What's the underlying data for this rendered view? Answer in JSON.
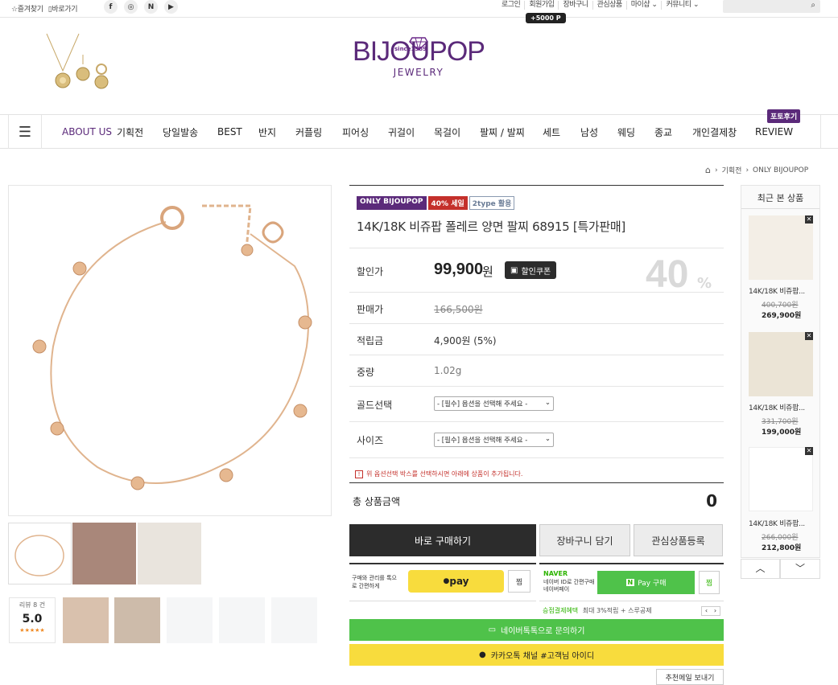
{
  "topbar": {
    "bookmark": "☆즐겨찾기",
    "shortcut": "▯바로가기",
    "links": [
      "로그인",
      "회원가입",
      "장바구니",
      "관심상품",
      "마이샵 ⌄",
      "커뮤니티 ⌄"
    ],
    "point_tag": "+5000 P"
  },
  "logo": {
    "since": "since1989",
    "main": "BIJOUPOP",
    "sub": "JEWELRY"
  },
  "nav": {
    "items": [
      "ABOUT US",
      "기획전",
      "당일발송",
      "BEST",
      "반지",
      "커플링",
      "피어싱",
      "귀걸이",
      "목걸이",
      "팔찌 / 발찌",
      "세트",
      "남성",
      "웨딩",
      "종교",
      "개인결제창",
      "REVIEW"
    ],
    "photo_review": "포토후기"
  },
  "breadcrumb": [
    "기획전",
    "ONLY BIJOUPOP"
  ],
  "product": {
    "badges": [
      "ONLY BIJOUPOP",
      "40% 세일",
      "2type 활용"
    ],
    "title": "14K/18K 비쥬팝 폴레르 양면 팔찌 68915 [특가판매]",
    "sale_label": "할인가",
    "sale_price": "99,900",
    "won": "원",
    "coupon": "할인쿠폰",
    "discount_num": "40",
    "discount_pct": "%",
    "orig_label": "판매가",
    "orig_price": "166,500원",
    "point_label": "적립금",
    "point_value": "4,900원 (5%)",
    "weight_label": "중량",
    "weight_value": "1.02g",
    "gold_label": "골드선택",
    "size_label": "사이즈",
    "select_placeholder": "- [필수] 옵션을 선택해 주세요 -",
    "notice": "위 옵션선택 박스를 선택하시면 아래에 상품이 추가됩니다.",
    "total_label": "총 상품금액",
    "total_value": "0"
  },
  "reviews": {
    "label": "리뷰 8 건",
    "score": "5.0",
    "stars": "★★★★★"
  },
  "buttons": {
    "buy": "바로 구매하기",
    "cart": "장바구니 담기",
    "wish": "관심상품등록",
    "kakao_desc": "구매와 관리를 톡으로 간편하게",
    "kakao_pay": "pay",
    "zzim": "찜",
    "naver_brand": "NAVER",
    "naver_desc": "네이버 ID로 간편구매 네이버페이",
    "naver_pay": "Pay 구매",
    "naver_benefit": "승점결제혜택",
    "naver_benefit_desc": "최대 3%적립 + 스루공제",
    "talk": "네이버톡톡으로 문의하기",
    "kakao_channel": "카카오톡 채널 #고객님 아이디",
    "recommend_mail": "추천메일 보내기"
  },
  "recent": {
    "title": "최근 본 상품",
    "items": [
      {
        "name": "14K/18K 비쥬팝...",
        "old": "400,700원",
        "new": "269,900원"
      },
      {
        "name": "14K/18K 비쥬팝...",
        "old": "331,700원",
        "new": "199,000원"
      },
      {
        "name": "14K/18K 비쥬팝...",
        "old": "266,000원",
        "new": "212,800원"
      }
    ]
  },
  "colors": {
    "brand": "#5b2a7a",
    "sale_red": "#c4302b",
    "buy_dark": "#2c2c2c",
    "naver_green": "#4fc24a",
    "kakao_yellow": "#f8dc3d"
  }
}
